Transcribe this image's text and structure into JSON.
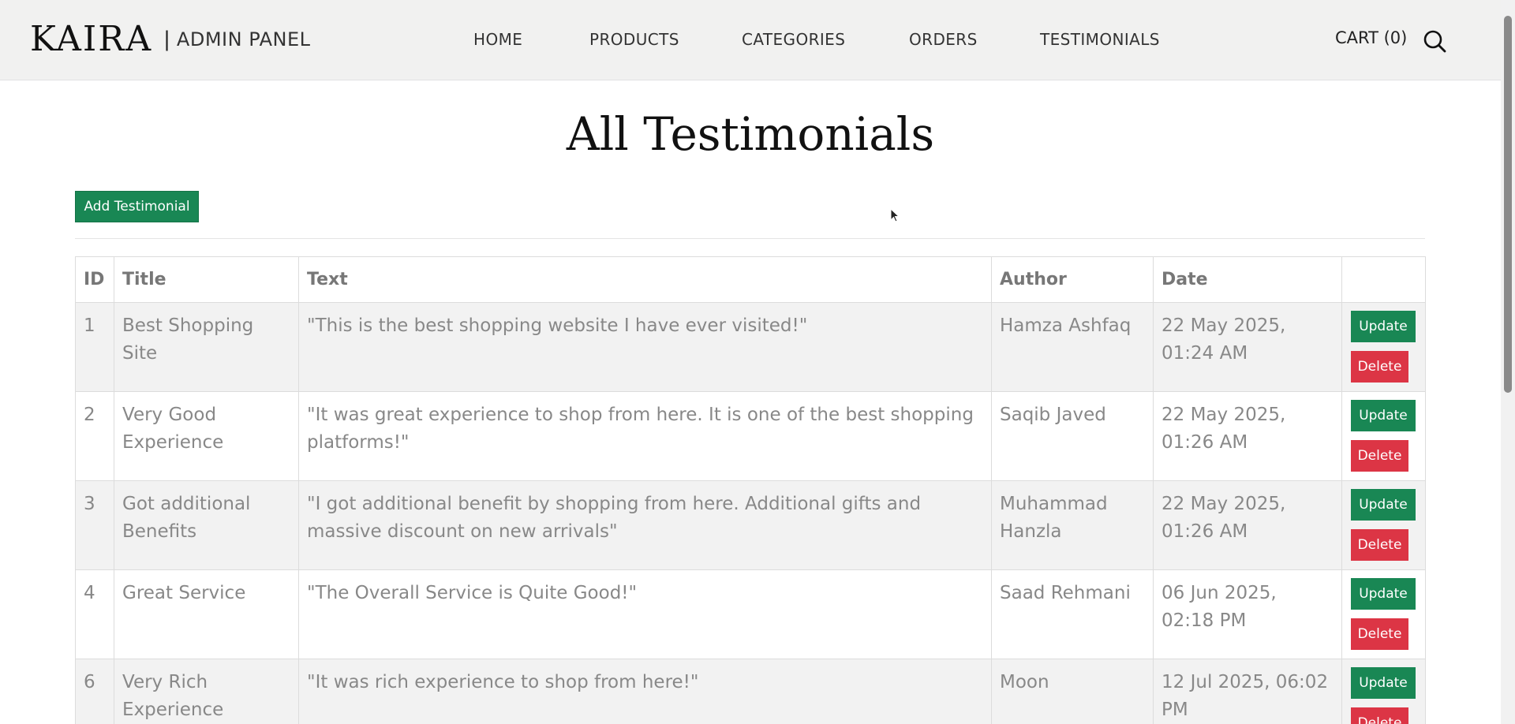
{
  "header": {
    "logo": "KAIRA",
    "separator": "|",
    "subtitle": "ADMIN PANEL",
    "nav": [
      "HOME",
      "PRODUCTS",
      "CATEGORIES",
      "ORDERS",
      "TESTIMONIALS"
    ],
    "cart_label": "CART (0)"
  },
  "main": {
    "title": "All Testimonials",
    "add_button": "Add Testimonial",
    "columns": [
      "ID",
      "Title",
      "Text",
      "Author",
      "Date",
      ""
    ],
    "rows": [
      {
        "id": "1",
        "title": "Best Shopping Site",
        "text": "\"This is the best shopping website I have ever visited!\"",
        "author": "Hamza Ashfaq",
        "date": "22 May 2025, 01:24 AM"
      },
      {
        "id": "2",
        "title": "Very Good Experience",
        "text": "\"It was great experience to shop from here. It is one of the best shopping platforms!\"",
        "author": "Saqib Javed",
        "date": "22 May 2025, 01:26 AM"
      },
      {
        "id": "3",
        "title": "Got additional Benefits",
        "text": "\"I got additional benefit by shopping from here. Additional gifts and massive discount on new arrivals\"",
        "author": "Muhammad Hanzla",
        "date": "22 May 2025, 01:26 AM"
      },
      {
        "id": "4",
        "title": "Great Service",
        "text": "\"The Overall Service is Quite Good!\"",
        "author": "Saad Rehmani",
        "date": "06 Jun 2025, 02:18 PM"
      },
      {
        "id": "6",
        "title": "Very Rich Experience",
        "text": "\"It was rich experience to shop from here!\"",
        "author": "Moon",
        "date": "12 Jul 2025, 06:02 PM"
      }
    ],
    "update_label": "Update",
    "delete_label": "Delete"
  },
  "colors": {
    "header_bg": "#f1f1f0",
    "success": "#198754",
    "danger": "#dc3545",
    "row_stripe": "#f2f2f2"
  }
}
